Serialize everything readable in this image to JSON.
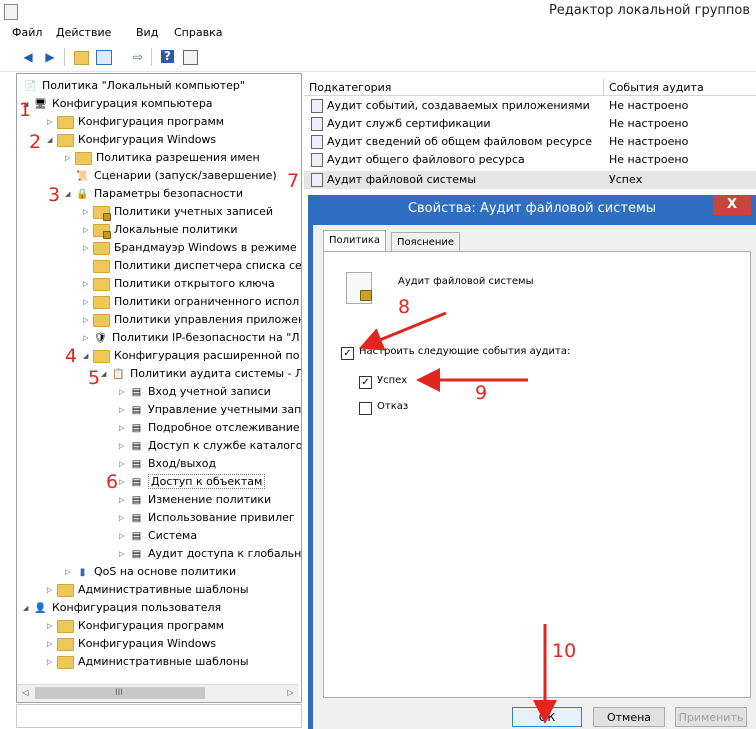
{
  "window": {
    "title": "Редактор локальной группов"
  },
  "menu": [
    "Файл",
    "Действие",
    "Вид",
    "Справка"
  ],
  "toolbar": {
    "icons": [
      "back-arrow-icon",
      "forward-arrow-icon",
      "up-folder-icon",
      "show-tree-icon",
      "export-list-icon",
      "help-icon",
      "properties-icon"
    ]
  },
  "tree": [
    {
      "label": "Политика \"Локальный компьютер\"",
      "icon": "computer-policy-icon"
    },
    {
      "label": "Конфигурация компьютера",
      "icon": "computer-icon"
    },
    {
      "label": "Конфигурация программ",
      "icon": "folder-icon"
    },
    {
      "label": "Конфигурация Windows",
      "icon": "folder-icon"
    },
    {
      "label": "Политика разрешения имен",
      "icon": "folder-icon"
    },
    {
      "label": "Сценарии (запуск/завершение)",
      "icon": "script-icon"
    },
    {
      "label": "Параметры безопасности",
      "icon": "security-icon"
    },
    {
      "label": "Политики учетных записей",
      "icon": "folder-lock-icon"
    },
    {
      "label": "Локальные политики",
      "icon": "folder-lock-icon"
    },
    {
      "label": "Брандмауэр Windows в режиме",
      "icon": "folder-icon"
    },
    {
      "label": "Политики диспетчера списка се",
      "icon": "folder-icon"
    },
    {
      "label": "Политики открытого ключа",
      "icon": "folder-icon"
    },
    {
      "label": "Политики ограниченного испол",
      "icon": "folder-icon"
    },
    {
      "label": "Политики управления приложен",
      "icon": "folder-icon"
    },
    {
      "label": "Политики IP-безопасности на \"Л",
      "icon": "ipsec-icon"
    },
    {
      "label": "Конфигурация расширенной по",
      "icon": "folder-icon"
    },
    {
      "label": "Политики аудита системы - Л",
      "icon": "audit-icon"
    },
    {
      "label": "Вход учетной записи",
      "icon": "policy-list-icon"
    },
    {
      "label": "Управление учетными зап",
      "icon": "policy-list-icon"
    },
    {
      "label": "Подробное отслеживание",
      "icon": "policy-list-icon"
    },
    {
      "label": "Доступ к службе каталого",
      "icon": "policy-list-icon"
    },
    {
      "label": "Вход/выход",
      "icon": "policy-list-icon"
    },
    {
      "label": "Доступ к объектам",
      "icon": "policy-list-icon"
    },
    {
      "label": "Изменение политики",
      "icon": "policy-list-icon"
    },
    {
      "label": "Использование привилег",
      "icon": "policy-list-icon"
    },
    {
      "label": "Система",
      "icon": "policy-list-icon"
    },
    {
      "label": "Аудит доступа к глобальн",
      "icon": "policy-list-icon"
    },
    {
      "label": "QoS на основе политики",
      "icon": "qos-chart-icon"
    },
    {
      "label": "Административные шаблоны",
      "icon": "folder-icon"
    },
    {
      "label": "Конфигурация пользователя",
      "icon": "user-icon"
    },
    {
      "label": "Конфигурация программ",
      "icon": "folder-icon"
    },
    {
      "label": "Конфигурация Windows",
      "icon": "folder-icon"
    },
    {
      "label": "Административные шаблоны",
      "icon": "folder-icon"
    }
  ],
  "hscroll": {
    "left": "◁",
    "right": "▷",
    "grip": "III"
  },
  "list": {
    "columns": [
      "Подкатегория",
      "События аудита"
    ],
    "rows": [
      {
        "name": "Аудит событий, создаваемых приложениями",
        "value": "Не настроено"
      },
      {
        "name": "Аудит служб сертификации",
        "value": "Не настроено"
      },
      {
        "name": "Аудит сведений об общем файловом ресурсе",
        "value": "Не настроено"
      },
      {
        "name": "Аудит общего файлового ресурса",
        "value": "Не настроено"
      },
      {
        "name": "Аудит файловой системы",
        "value": "Успех"
      }
    ]
  },
  "dialog": {
    "title": "Свойства: Аудит файловой системы",
    "close": "X",
    "tabs": [
      "Политика",
      "Пояснение"
    ],
    "policy_name": "Аудит файловой системы",
    "configure_label": "Настроить следующие события аудита:",
    "success_label": "Успех",
    "failure_label": "Отказ",
    "checked_mark": "✓",
    "buttons": {
      "ok": "ОК",
      "cancel": "Отмена",
      "apply": "Применить"
    }
  },
  "annotations": [
    "1",
    "2",
    "3",
    "4",
    "5",
    "6",
    "7",
    "8",
    "9",
    "10"
  ],
  "colors": {
    "annotation": "#e0261f",
    "dialog_frame": "#2f6fc1",
    "close_button": "#c7453a"
  }
}
